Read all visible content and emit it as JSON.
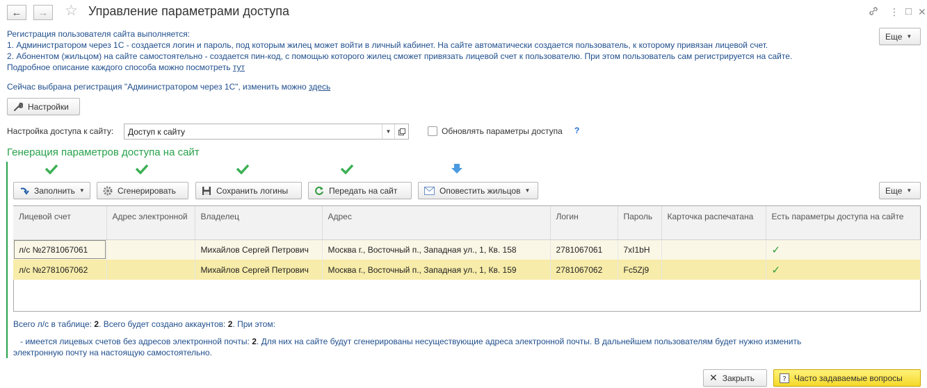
{
  "window": {
    "title": "Управление параметрами доступа"
  },
  "info": {
    "line1": "Регистрация пользователя сайта выполняется:",
    "line2": "1. Администратором через 1С - создается логин и пароль, под которым жилец может войти в личный кабинет. На сайте автоматически создается пользователь, к которому привязан лицевой счет.",
    "line3": "2. Абонентом (жильцом) на сайте самостоятельно - создается пин-код, с помощью которого жилец сможет привязать лицевой счет к пользователю. При этом пользователь сам регистрируется на сайте.",
    "line4": "Подробное описание каждого способа можно посмотреть ",
    "line4_link": "тут",
    "current": "Сейчас выбрана регистрация \"Администратором через 1С\", изменить можно ",
    "current_link": "здесь"
  },
  "toolbar": {
    "more_label": "Еще",
    "settings_label": "Настройки"
  },
  "access": {
    "label": "Настройка доступа к сайту:",
    "value": "Доступ к сайту",
    "update_label": "Обновлять параметры доступа",
    "help": "?"
  },
  "generation": {
    "title": "Генерация параметров доступа на сайт",
    "buttons": {
      "fill": "Заполнить",
      "generate": "Сгенерировать",
      "save_logins": "Сохранить логины",
      "send_to_site": "Передать на сайт",
      "notify": "Оповестить жильцов",
      "more": "Еще"
    }
  },
  "table": {
    "columns": [
      "Лицевой счет",
      "Адрес электронной",
      "Владелец",
      "Адрес",
      "Логин",
      "Пароль",
      "Карточка распечатана",
      "Есть параметры доступа на сайте"
    ],
    "rows": [
      {
        "account": "л/с №2781067061",
        "email": "",
        "owner": "Михайлов Сергей Петрович",
        "address": "Москва г., Восточный п., Западная ул., 1, Кв. 158",
        "login": "2781067061",
        "password": "7xI1bH",
        "printed": "",
        "has_access": "✓"
      },
      {
        "account": "л/с №2781067062",
        "email": "",
        "owner": "Михайлов Сергей Петрович",
        "address": "Москва г., Восточный п., Западная ул., 1, Кв. 159",
        "login": "2781067062",
        "password": "Fc5Zj9",
        "printed": "",
        "has_access": "✓"
      }
    ]
  },
  "summary": {
    "t1": "Всего л/с в таблице: ",
    "n1": "2",
    "t2": ". Всего будет создано аккаунтов: ",
    "n2": "2",
    "t3": ". При этом:",
    "d1": " - имеется лицевых счетов без адресов электронной почты: ",
    "dn": "2",
    "d2": ". Для них на сайте будут сгенерированы несуществующие адреса электронной почты. В дальнейшем пользователям будет нужно изменить",
    "d3": "электронную почту на настоящую самостоятельно."
  },
  "footer": {
    "close_label": "Закрыть",
    "faq_label": "Часто задаваемые вопросы"
  },
  "colors": {
    "link": "#1f4e8c",
    "group_title": "#27a14a",
    "row_selected": "#f7eca9",
    "faq_button": "#f5d92a"
  }
}
